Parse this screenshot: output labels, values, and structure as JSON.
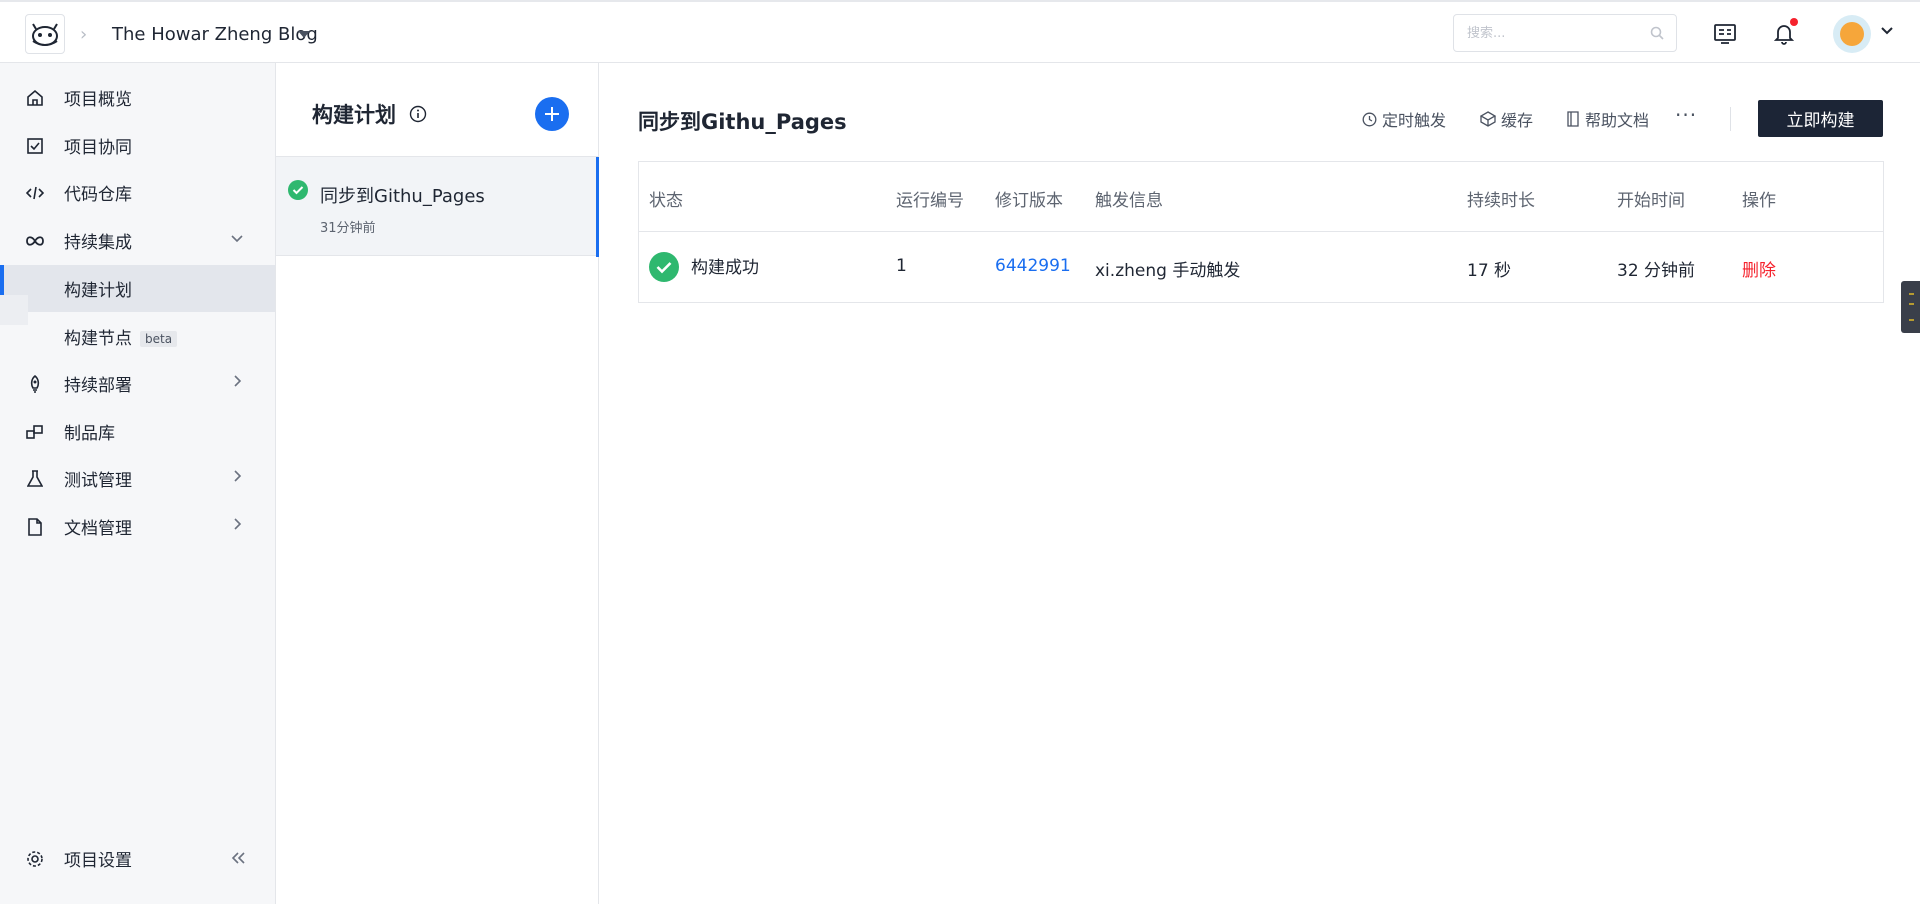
{
  "topbar": {
    "project_name": "The Howar Zheng Blog",
    "search_placeholder": "搜索...",
    "icons": [
      "logo-icon",
      "chevron-right-icon",
      "caret-down-icon",
      "search-icon",
      "dashboard-icon",
      "bell-icon",
      "avatar",
      "chevron-down-icon"
    ]
  },
  "sidebar": {
    "items": [
      {
        "label": "项目概览",
        "icon": "home-icon"
      },
      {
        "label": "项目协同",
        "icon": "checkbox-icon"
      },
      {
        "label": "代码仓库",
        "icon": "code-icon"
      },
      {
        "label": "持续集成",
        "icon": "infinity-icon",
        "expanded": true
      },
      {
        "label": "构建计划",
        "active": true
      },
      {
        "label": "构建节点",
        "badge": "beta"
      },
      {
        "label": "持续部署",
        "icon": "rocket-icon"
      },
      {
        "label": "制品库",
        "icon": "package-icon"
      },
      {
        "label": "测试管理",
        "icon": "flask-icon"
      },
      {
        "label": "文档管理",
        "icon": "document-icon"
      }
    ],
    "settings_label": "项目设置"
  },
  "plans": {
    "title": "构建计划",
    "items": [
      {
        "name": "同步到Githu_Pages",
        "time": "31分钟前",
        "status": "success"
      }
    ]
  },
  "main": {
    "title": "同步到Githu_Pages",
    "toolbar": {
      "schedule_label": "定时触发",
      "cache_label": "缓存",
      "docs_label": "帮助文档",
      "more_label": "···",
      "build_now_label": "立即构建"
    },
    "table": {
      "columns": [
        "状态",
        "运行编号",
        "修订版本",
        "触发信息",
        "持续时长",
        "开始时间",
        "操作"
      ],
      "rows": [
        {
          "status": "构建成功",
          "run": "1",
          "revision": "6442991",
          "trigger": "xi.zheng 手动触发",
          "duration": "17 秒",
          "started": "32 分钟前",
          "action": "删除"
        }
      ]
    }
  },
  "colors": {
    "accent": "#1a6ef0",
    "success": "#2fb86f",
    "danger": "#f5222d",
    "dark_button": "#1c2536"
  }
}
